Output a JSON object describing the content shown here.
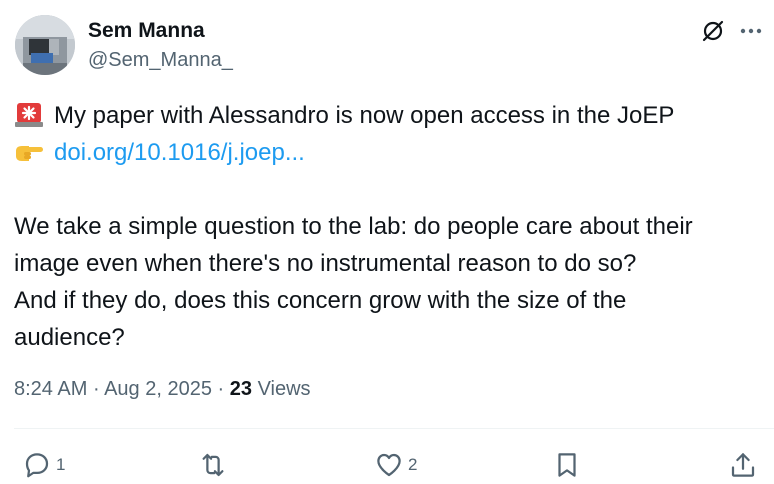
{
  "author": {
    "name": "Sem Manna",
    "handle": "@Sem_Manna_"
  },
  "post": {
    "line1": "My paper with Alessandro is now open access in the JoEP",
    "link": "doi.org/10.1016/j.joep...",
    "para": [
      "We take a simple question to the lab: do people care about their",
      "image even when there's no instrumental reason to do so?",
      "And if they do, does this concern grow with the size of the",
      "audience?"
    ],
    "emoji1": "rotating-light-icon",
    "emoji2": "pointing-hand-icon"
  },
  "meta": {
    "time": "8:24 AM",
    "sep1": "·",
    "date": "Aug 2, 2025",
    "sep2": "·",
    "views_count": "23",
    "views_label": "Views"
  },
  "actions": {
    "reply_count": "1",
    "like_count": "2"
  },
  "colors": {
    "link": "#1d9bf0",
    "secondary": "#536471",
    "text": "#0f1419"
  }
}
